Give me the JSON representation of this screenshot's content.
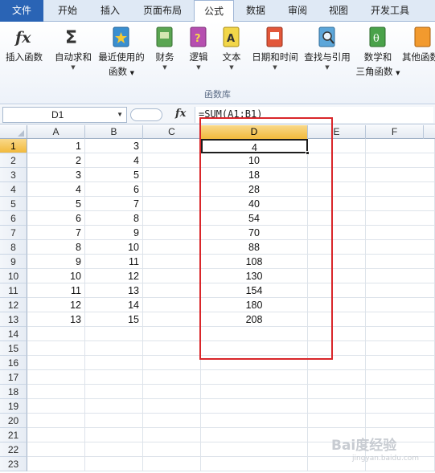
{
  "tabs": [
    {
      "label": "文件"
    },
    {
      "label": "开始"
    },
    {
      "label": "插入"
    },
    {
      "label": "页面布局"
    },
    {
      "label": "公式"
    },
    {
      "label": "数据"
    },
    {
      "label": "审阅"
    },
    {
      "label": "视图"
    },
    {
      "label": "开发工具"
    }
  ],
  "ribbon": {
    "group_label": "函数库",
    "buttons": [
      {
        "label": "插入函数",
        "label2": "",
        "icon": "fx-icon"
      },
      {
        "label": "自动求和",
        "label2": "",
        "icon": "sigma-icon"
      },
      {
        "label": "最近使用的",
        "label2": "函数",
        "icon": "recent-functions-book-icon"
      },
      {
        "label": "财务",
        "label2": "",
        "icon": "financial-book-icon"
      },
      {
        "label": "逻辑",
        "label2": "",
        "icon": "logical-book-icon"
      },
      {
        "label": "文本",
        "label2": "",
        "icon": "text-book-icon"
      },
      {
        "label": "日期和时间",
        "label2": "",
        "icon": "date-time-book-icon"
      },
      {
        "label": "查找与引用",
        "label2": "",
        "icon": "lookup-book-icon"
      },
      {
        "label": "数学和",
        "label2": "三角函数",
        "icon": "math-trig-book-icon"
      },
      {
        "label": "其他函数",
        "label2": "",
        "icon": "more-functions-book-icon"
      }
    ]
  },
  "formula_bar": {
    "name_box": "D1",
    "fx_symbol": "fx",
    "formula": "=SUM(A1:B1)"
  },
  "columns": [
    "A",
    "B",
    "C",
    "D",
    "E",
    "F"
  ],
  "selected_cell": "D1",
  "rows": [
    {
      "n": "1",
      "a": "1",
      "b": "3",
      "d": "4"
    },
    {
      "n": "2",
      "a": "2",
      "b": "4",
      "d": "10"
    },
    {
      "n": "3",
      "a": "3",
      "b": "5",
      "d": "18"
    },
    {
      "n": "4",
      "a": "4",
      "b": "6",
      "d": "28"
    },
    {
      "n": "5",
      "a": "5",
      "b": "7",
      "d": "40"
    },
    {
      "n": "6",
      "a": "6",
      "b": "8",
      "d": "54"
    },
    {
      "n": "7",
      "a": "7",
      "b": "9",
      "d": "70"
    },
    {
      "n": "8",
      "a": "8",
      "b": "10",
      "d": "88"
    },
    {
      "n": "9",
      "a": "9",
      "b": "11",
      "d": "108"
    },
    {
      "n": "10",
      "a": "10",
      "b": "12",
      "d": "130"
    },
    {
      "n": "11",
      "a": "11",
      "b": "13",
      "d": "154"
    },
    {
      "n": "12",
      "a": "12",
      "b": "14",
      "d": "180"
    },
    {
      "n": "13",
      "a": "13",
      "b": "15",
      "d": "208"
    },
    {
      "n": "14",
      "a": "",
      "b": "",
      "d": ""
    },
    {
      "n": "15",
      "a": "",
      "b": "",
      "d": ""
    },
    {
      "n": "16",
      "a": "",
      "b": "",
      "d": ""
    },
    {
      "n": "17",
      "a": "",
      "b": "",
      "d": ""
    },
    {
      "n": "18",
      "a": "",
      "b": "",
      "d": ""
    },
    {
      "n": "19",
      "a": "",
      "b": "",
      "d": ""
    },
    {
      "n": "20",
      "a": "",
      "b": "",
      "d": ""
    },
    {
      "n": "21",
      "a": "",
      "b": "",
      "d": ""
    },
    {
      "n": "22",
      "a": "",
      "b": "",
      "d": ""
    },
    {
      "n": "23",
      "a": "",
      "b": "",
      "d": ""
    }
  ],
  "highlight_color": "#d9262a",
  "watermark": {
    "text": "Bai度经验",
    "sub": "jingyan.baidu.com"
  }
}
